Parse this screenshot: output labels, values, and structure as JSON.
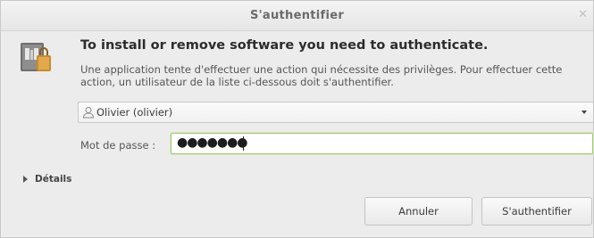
{
  "window": {
    "title": "S'authentifier",
    "close_icon": "close-icon"
  },
  "dialog": {
    "icon": "package-lock-icon",
    "heading": "To install or remove software you need to authenticate.",
    "description": "Une application tente d'effectuer une action qui nécessite des privilèges. Pour effectuer cette action, un utilisateur de la liste ci-dessous doit s'authentifier."
  },
  "user_select": {
    "icon": "user-icon",
    "selected": "Olivier (olivier)"
  },
  "password": {
    "label": "Mot de passe :",
    "masked_value": "●●●●●●●"
  },
  "details": {
    "label": "Détails"
  },
  "buttons": {
    "cancel": "Annuler",
    "authenticate": "S'authentifier"
  }
}
